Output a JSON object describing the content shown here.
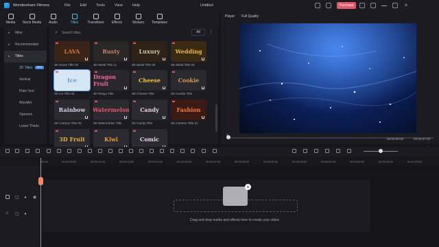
{
  "app": {
    "name": "Wondershare Filmora",
    "document_title": "Untitled",
    "purchase_label": "Purchase"
  },
  "menu": [
    "File",
    "Edit",
    "Tools",
    "View",
    "Help"
  ],
  "toolbar": [
    {
      "label": "Media",
      "icon": "media-icon"
    },
    {
      "label": "Stock Media",
      "icon": "stock-media-icon"
    },
    {
      "label": "Audio",
      "icon": "audio-icon"
    },
    {
      "label": "Titles",
      "icon": "titles-icon",
      "active": true
    },
    {
      "label": "Transitions",
      "icon": "transitions-icon"
    },
    {
      "label": "Effects",
      "icon": "effects-icon"
    },
    {
      "label": "Stickers",
      "icon": "stickers-icon"
    },
    {
      "label": "Templates",
      "icon": "templates-icon"
    }
  ],
  "leftnav": [
    {
      "label": "Mine",
      "type": "parent"
    },
    {
      "label": "Recommended",
      "type": "parent"
    },
    {
      "label": "Titles",
      "type": "parent",
      "active": true
    },
    {
      "label": "3D Titles",
      "type": "sub",
      "selected": true,
      "badge": "NEW"
    },
    {
      "label": "Vertical",
      "type": "sub"
    },
    {
      "label": "Plain Text",
      "type": "sub"
    },
    {
      "label": "WordArt",
      "type": "sub"
    },
    {
      "label": "Openers",
      "type": "sub"
    },
    {
      "label": "Lower Thirds",
      "type": "sub"
    }
  ],
  "search": {
    "placeholder": "Search titles",
    "filter": "All"
  },
  "titles": [
    {
      "thumb": "LAVA",
      "caption": "3D Stone Title 02",
      "bg": "#3a2417",
      "fg": "#d47a2c"
    },
    {
      "thumb": "Rusty",
      "caption": "3D Metal Title 11",
      "bg": "#2b2626",
      "fg": "#c6866a"
    },
    {
      "thumb": "Luxury",
      "caption": "3D Metal Title 08",
      "bg": "#2c2217",
      "fg": "#d9c8a4"
    },
    {
      "thumb": "Wedding",
      "caption": "3D Metal Title 03",
      "bg": "#3a2a14",
      "fg": "#e3b84a"
    },
    {
      "thumb": "Ice",
      "caption": "3D Ice Title 03",
      "bg": "#d7e6f5",
      "fg": "#6aa0c8",
      "selected": true
    },
    {
      "thumb": "Dragon Fruit",
      "caption": "3D Pitaya Title",
      "bg": "#2a2630",
      "fg": "#f06a8e"
    },
    {
      "thumb": "Cheese",
      "caption": "3D Cheese Title",
      "bg": "#2a2a2e",
      "fg": "#f2c23a"
    },
    {
      "thumb": "Cookie",
      "caption": "3D Cookie Title",
      "bg": "#2a2a2e",
      "fg": "#d49a5a"
    },
    {
      "thumb": "Rainbow",
      "caption": "3D Cartoon Title 03",
      "bg": "#2a2a30",
      "fg": "#cfd7e8"
    },
    {
      "thumb": "Watermelon",
      "caption": "3D Watermelon Title",
      "bg": "#2a2a30",
      "fg": "#e65a6a"
    },
    {
      "thumb": "Candy",
      "caption": "3D Candy Title",
      "bg": "#2a2a30",
      "fg": "#f0d0e6"
    },
    {
      "thumb": "Fashion",
      "caption": "3D Cartoon Title 01",
      "bg": "#3a1a12",
      "fg": "#f07a3a"
    },
    {
      "thumb": "3D Fruit",
      "caption": "",
      "bg": "#2a2a30",
      "fg": "#e8b040"
    },
    {
      "thumb": "Kiwi",
      "caption": "",
      "bg": "#2a2a30",
      "fg": "#e0a040"
    },
    {
      "thumb": "Comic",
      "caption": "",
      "bg": "#2a2a30",
      "fg": "#e8d8f0"
    }
  ],
  "player": {
    "label": "Player",
    "quality": "Full Quality",
    "time_current": "00:00:00:00",
    "time_total": "00:00:07:00"
  },
  "ruler": [
    "00:00",
    "00:00:05:00",
    "00:00:10:00",
    "00:00:15:00",
    "00:00:20:00",
    "00:00:25:00",
    "00:00:30:00",
    "00:00:35:00",
    "00:00:40:00",
    "00:00:45:00",
    "00:00:50:00",
    "00:00:55:00",
    "00:01:00:00",
    "00:01:05:00"
  ],
  "timeline": {
    "drop_hint": "Drag and drop media and effects here to create your video."
  }
}
